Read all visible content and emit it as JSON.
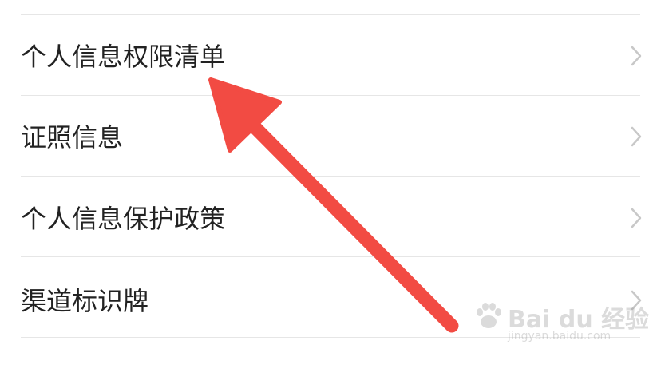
{
  "menu": {
    "items": [
      {
        "label": "个人信息权限清单"
      },
      {
        "label": "证照信息"
      },
      {
        "label": "个人信息保护政策"
      },
      {
        "label": "渠道标识牌"
      }
    ]
  },
  "icons": {
    "row_chevron": "chevron-right-icon",
    "annotation": "arrow-pointer-icon"
  },
  "colors": {
    "arrow": "#f24b43",
    "divider": "#e6e6e6",
    "text": "#222222",
    "chevron": "#c8c8c8"
  },
  "watermark": {
    "brand": "Bai du 经验",
    "url": "jingyan.baidu.com"
  }
}
